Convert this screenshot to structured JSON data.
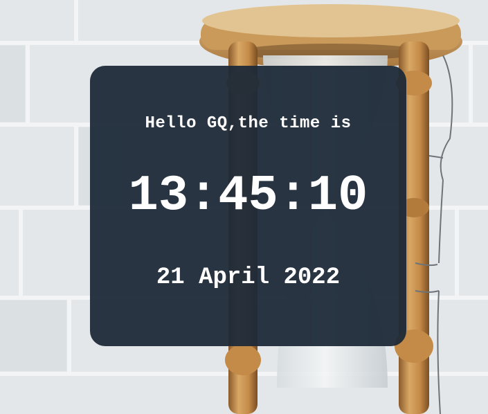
{
  "clock": {
    "greeting": "Hello GQ,the time is",
    "time": "13:45:10",
    "date": "21 April 2022"
  },
  "background": {
    "subject": "hourglass-on-brick-wall",
    "wall_color": "#e4e8ea",
    "wood_color": "#c9954f"
  },
  "card": {
    "background_color": "#1e2a38",
    "text_color": "#ffffff"
  }
}
